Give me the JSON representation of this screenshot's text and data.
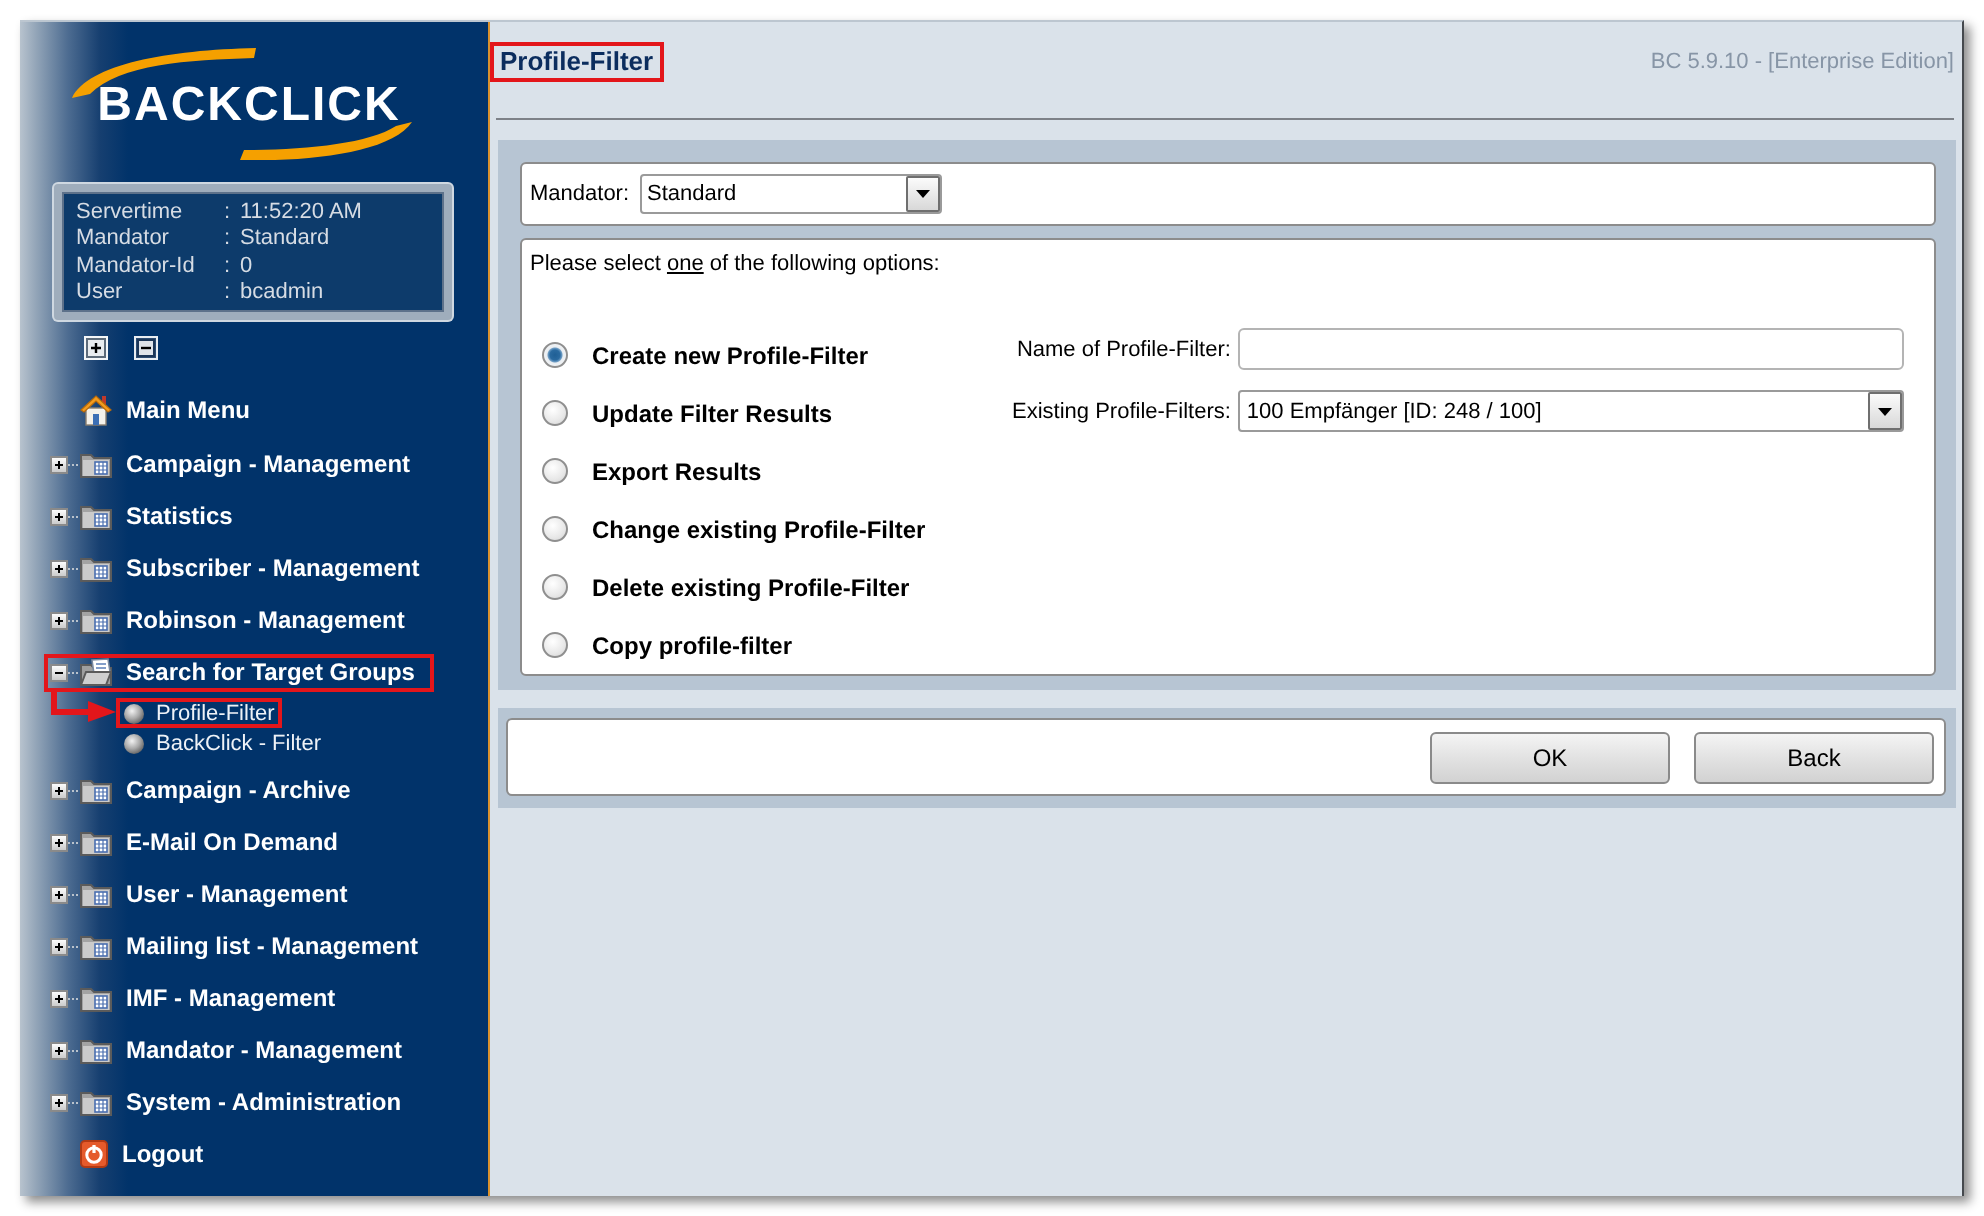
{
  "logo": {
    "text": "BACKCLICK"
  },
  "server_info": [
    {
      "label": "Servertime",
      "separator": ":",
      "value": "11:52:20 AM"
    },
    {
      "label": "Mandator",
      "separator": ":",
      "value": "Standard"
    },
    {
      "label": "Mandator-Id",
      "separator": ":",
      "value": "0"
    },
    {
      "label": "User",
      "separator": ":",
      "value": "bcadmin"
    }
  ],
  "menu": [
    {
      "kind": "home",
      "label": "Main Menu",
      "highlighted": false
    },
    {
      "kind": "folder",
      "label": "Campaign - Management",
      "expanded": false,
      "highlighted": false
    },
    {
      "kind": "folder",
      "label": "Statistics",
      "expanded": false,
      "highlighted": false
    },
    {
      "kind": "folder",
      "label": "Subscriber - Management",
      "expanded": false,
      "highlighted": false
    },
    {
      "kind": "folder",
      "label": "Robinson - Management",
      "expanded": false,
      "highlighted": false
    },
    {
      "kind": "folder",
      "label": "Search for Target Groups",
      "expanded": true,
      "highlighted": true,
      "children": [
        {
          "label": "Profile-Filter",
          "highlighted": true
        },
        {
          "label": "BackClick - Filter",
          "highlighted": false
        }
      ]
    },
    {
      "kind": "folder",
      "label": "Campaign - Archive",
      "expanded": false,
      "highlighted": false
    },
    {
      "kind": "folder",
      "label": "E-Mail On Demand",
      "expanded": false,
      "highlighted": false
    },
    {
      "kind": "folder",
      "label": "User - Management",
      "expanded": false,
      "highlighted": false
    },
    {
      "kind": "folder",
      "label": "Mailing list - Management",
      "expanded": false,
      "highlighted": false
    },
    {
      "kind": "folder",
      "label": "IMF - Management",
      "expanded": false,
      "highlighted": false
    },
    {
      "kind": "folder",
      "label": "Mandator - Management",
      "expanded": false,
      "highlighted": false
    },
    {
      "kind": "folder",
      "label": "System - Administration",
      "expanded": false,
      "highlighted": false
    },
    {
      "kind": "logout",
      "label": "Logout",
      "highlighted": false
    }
  ],
  "header": {
    "title": "Profile-Filter",
    "highlighted": true,
    "version": "BC 5.9.10 - [Enterprise Edition]"
  },
  "mandator": {
    "label": "Mandator:",
    "value": "Standard"
  },
  "options": {
    "prompt": {
      "before": "Please select ",
      "underlined": "one",
      "after": " of the following options:"
    },
    "items": [
      {
        "label": "Create new Profile-Filter",
        "selected": true
      },
      {
        "label": "Update Filter Results",
        "selected": false
      },
      {
        "label": "Export Results",
        "selected": false
      },
      {
        "label": "Change existing Profile-Filter",
        "selected": false
      },
      {
        "label": "Delete existing Profile-Filter",
        "selected": false
      },
      {
        "label": "Copy profile-filter",
        "selected": false
      }
    ]
  },
  "fields": [
    {
      "kind": "text",
      "label": "Name of Profile-Filter:"
    },
    {
      "kind": "select",
      "label": "Existing Profile-Filters:",
      "value": "100 Empfänger [ID: 248 / 100]"
    }
  ],
  "buttons": [
    "OK",
    "Back"
  ]
}
